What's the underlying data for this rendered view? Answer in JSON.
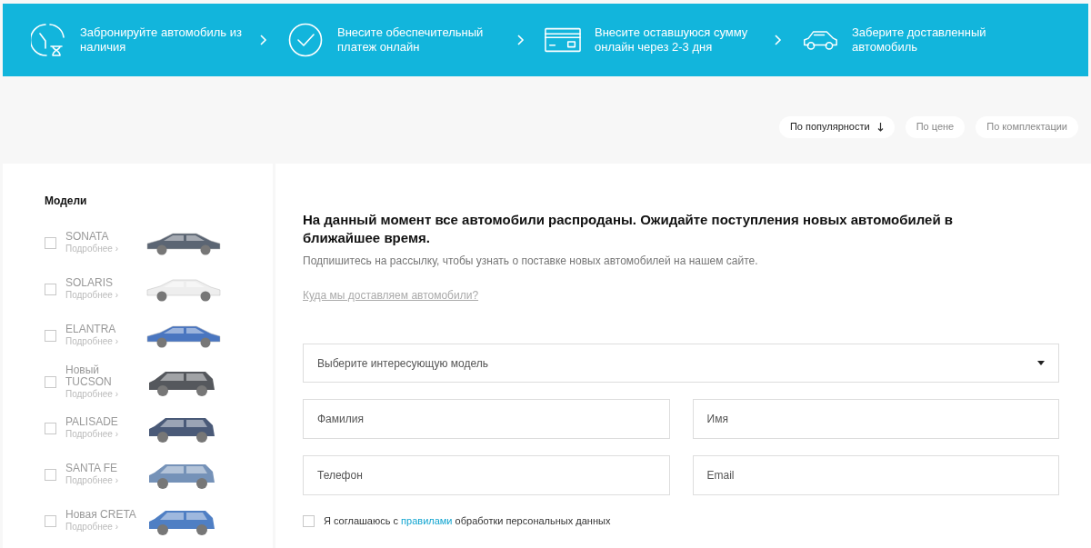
{
  "steps": [
    {
      "kind": "clock",
      "text": "Забронируйте автомобиль из наличия"
    },
    {
      "kind": "check",
      "text": "Внесите обеспечительный платеж онлайн"
    },
    {
      "kind": "card",
      "text": "Внесите оставшуюся сумму онлайн через 2-3 дня"
    },
    {
      "kind": "car",
      "text": "Заберите доставленный автомобиль"
    }
  ],
  "sort": [
    {
      "label": "По популярности",
      "selected": true
    },
    {
      "label": "По цене",
      "selected": false
    },
    {
      "label": "По комплектации",
      "selected": false
    }
  ],
  "sidebar": {
    "title": "Модели",
    "items": [
      {
        "name": "SONATA",
        "more": "Подробнее ›",
        "checked": false,
        "color": "#5b6573",
        "kind": "sedan"
      },
      {
        "name": "SOLARIS",
        "more": "Подробнее ›",
        "checked": false,
        "color": "#eeeeee",
        "kind": "sedan"
      },
      {
        "name": "ELANTRA",
        "more": "Подробнее ›",
        "checked": false,
        "color": "#4a76c0",
        "kind": "sedan"
      },
      {
        "name": "Новый TUCSON",
        "more": "Подробнее ›",
        "checked": false,
        "color": "#55585d",
        "kind": "suv"
      },
      {
        "name": "PALISADE",
        "more": "Подробнее ›",
        "checked": false,
        "color": "#4a5a78",
        "kind": "suv"
      },
      {
        "name": "SANTA FE",
        "more": "Подробнее ›",
        "checked": false,
        "color": "#7592b8",
        "kind": "suv"
      },
      {
        "name": "Новая CRETA",
        "more": "Подробнее ›",
        "checked": false,
        "color": "#4f7fc4",
        "kind": "suv"
      }
    ]
  },
  "main": {
    "heading": "На данный момент все автомобили распроданы. Ожидайте поступления новых автомобилей в ближайшее время.",
    "subtitle": "Подпишитесь на рассылку, чтобы узнать о поставке новых автомобилей на нашем сайте.",
    "link": "Куда мы доставляем автомобили?",
    "select": {
      "placeholder": "Выберите интересующую модель"
    },
    "fields": [
      {
        "placeholder": "Фамилия"
      },
      {
        "placeholder": "Имя"
      },
      {
        "placeholder": "Телефон"
      },
      {
        "placeholder": "Email"
      }
    ],
    "consent": {
      "checked": false,
      "before": "Я соглашаюсь с",
      "link": "правилами",
      "after": "обработки персональных данных"
    }
  }
}
